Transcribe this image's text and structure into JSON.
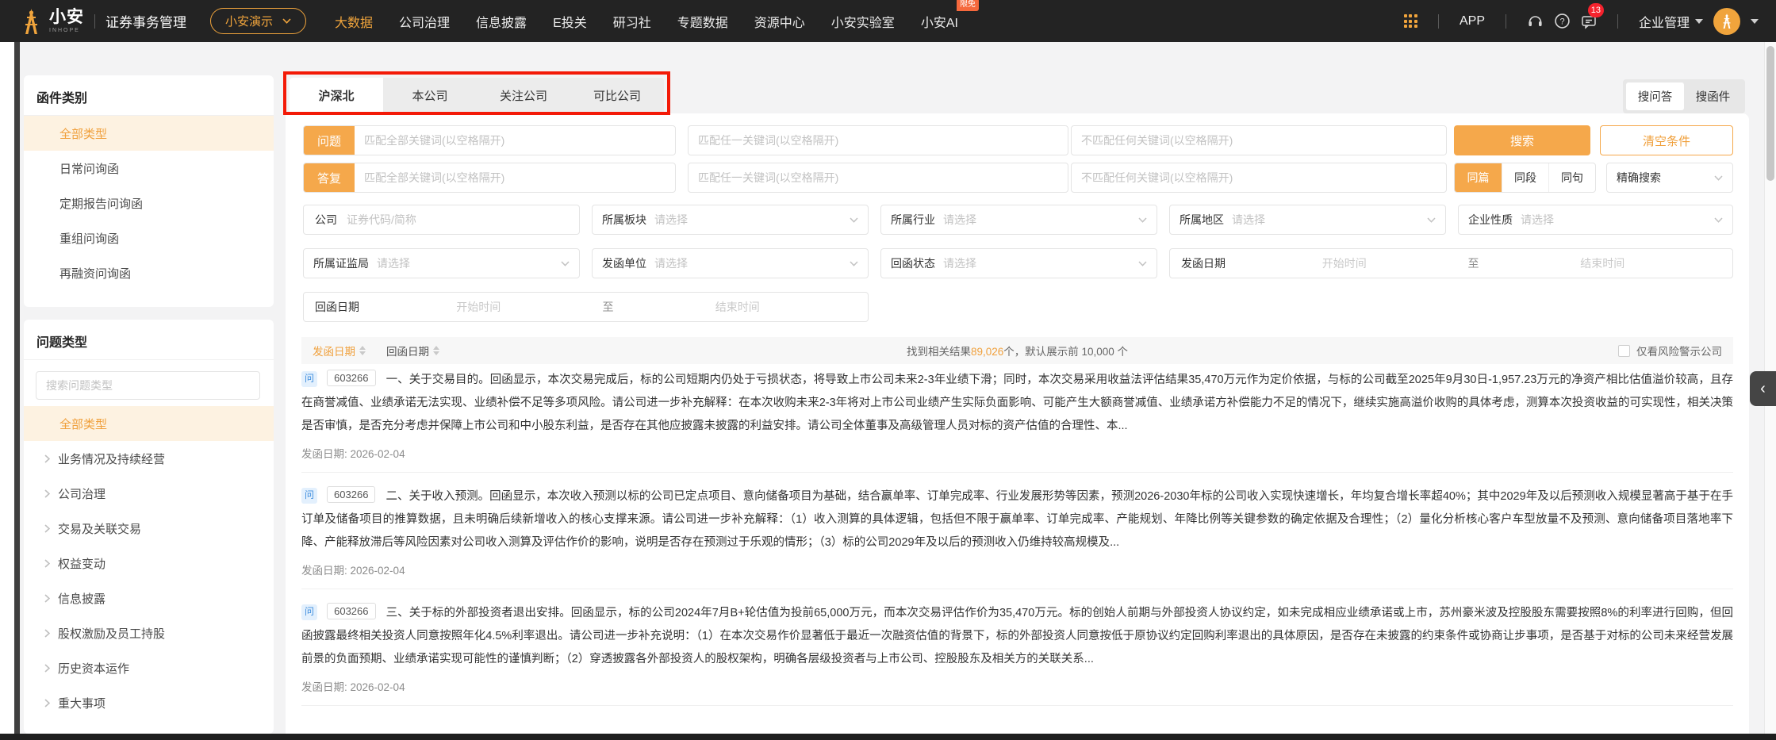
{
  "topbar": {
    "logo": {
      "text": "小安",
      "sub": "INHOPE"
    },
    "app_title": "证券事务管理",
    "env_selector": {
      "label": "小安演示"
    },
    "nav": [
      {
        "label": "大数据",
        "active": true
      },
      {
        "label": "公司治理"
      },
      {
        "label": "信息披露"
      },
      {
        "label": "E投关"
      },
      {
        "label": "研习社"
      },
      {
        "label": "专题数据"
      },
      {
        "label": "资源中心"
      },
      {
        "label": "小安实验室"
      },
      {
        "label": "小安AI",
        "badge": "限免"
      }
    ],
    "app_label": "APP",
    "message_badge": "13",
    "org_menu": {
      "label": "企业管理"
    }
  },
  "sidebar": {
    "letter_section": {
      "title": "函件类别",
      "items": [
        {
          "label": "全部类型",
          "selected": true
        },
        {
          "label": "日常问询函"
        },
        {
          "label": "定期报告问询函"
        },
        {
          "label": "重组问询函"
        },
        {
          "label": "再融资问询函"
        }
      ]
    },
    "question_section": {
      "title": "问题类型",
      "search_placeholder": "搜索问题类型",
      "all_item": {
        "label": "全部类型",
        "selected": true
      },
      "items": [
        {
          "label": "业务情况及持续经营"
        },
        {
          "label": "公司治理"
        },
        {
          "label": "交易及关联交易"
        },
        {
          "label": "权益变动"
        },
        {
          "label": "信息披露"
        },
        {
          "label": "股权激励及员工持股"
        },
        {
          "label": "历史资本运作"
        },
        {
          "label": "重大事项"
        }
      ]
    }
  },
  "main": {
    "tabs": [
      {
        "label": "沪深北",
        "active": true
      },
      {
        "label": "本公司"
      },
      {
        "label": "关注公司"
      },
      {
        "label": "可比公司"
      }
    ],
    "mode_toggle": [
      {
        "label": "搜问答",
        "active": true
      },
      {
        "label": "搜函件"
      }
    ],
    "search_form": {
      "question_label": "问题",
      "answer_label": "答复",
      "match_all_placeholder": "匹配全部关键词(以空格隔开)",
      "match_any_placeholder": "匹配任一关键词(以空格隔开)",
      "match_none_placeholder": "不匹配任何关键词(以空格隔开)",
      "search_button": "搜索",
      "clear_button": "清空条件",
      "scope_options": [
        {
          "label": "同篇",
          "active": true
        },
        {
          "label": "同段"
        },
        {
          "label": "同句"
        }
      ],
      "precise_select": "精确搜索"
    },
    "filters": {
      "company_label": "公司",
      "company_placeholder": "证券代码/简称",
      "select_placeholder": "请选择",
      "board_label": "所属板块",
      "industry_label": "所属行业",
      "region_label": "所属地区",
      "nature_label": "企业性质",
      "csrc_label": "所属证监局",
      "sender_label": "发函单位",
      "reply_status_label": "回函状态",
      "send_date_label": "发函日期",
      "reply_date_label": "回函日期",
      "date_start_placeholder": "开始时间",
      "date_to": "至",
      "date_end_placeholder": "结束时间"
    },
    "results": {
      "sort_send_date": "发函日期",
      "sort_reply_date": "回函日期",
      "count_prefix": "找到相关结果",
      "count": "89,026",
      "count_suffix": "个，默认展示前 10,000 个",
      "risk_filter_label": "仅看风险警示公司",
      "item_date_label": "发函日期: ",
      "items": [
        {
          "badge": "问",
          "code": "603266",
          "text": "一、关于交易目的。回函显示，本次交易完成后，标的公司短期内仍处于亏损状态，将导致上市公司未来2-3年业绩下滑；同时，本次交易采用收益法评估结果35,470万元作为定价依据，与标的公司截至2025年9月30日-1,957.23万元的净资产相比估值溢价较高，且存在商誉减值、业绩承诺无法实现、业绩补偿不足等多项风险。请公司进一步补充解释：在本次收购未来2-3年将对上市公司业绩产生实际负面影响、可能产生大额商誉减值、业绩承诺方补偿能力不足的情况下，继续实施高溢价收购的具体考虑，测算本次投资收益的可实现性，相关决策是否审慎，是否充分考虑并保障上市公司和中小股东利益，是否存在其他应披露未披露的利益安排。请公司全体董事及高级管理人员对标的资产估值的合理性、本...",
          "date": "2026-02-04"
        },
        {
          "badge": "问",
          "code": "603266",
          "text": "二、关于收入预测。回函显示，本次收入预测以标的公司已定点项目、意向储备项目为基础，结合赢单率、订单完成率、行业发展形势等因素，预测2026-2030年标的公司收入实现快速增长，年均复合增长率超40%；其中2029年及以后预测收入规模显著高于基于在手订单及储备项目的推算数据，且未明确后续新增收入的核心支撑来源。请公司进一步补充解释：（1）收入测算的具体逻辑，包括但不限于赢单率、订单完成率、产能规划、年降比例等关键参数的确定依据及合理性；（2）量化分析核心客户车型放量不及预测、意向储备项目落地率下降、产能释放滞后等风险因素对公司收入测算及评估作价的影响，说明是否存在预测过于乐观的情形；（3）标的公司2029年及以后的预测收入仍维持较高规模及...",
          "date": "2026-02-04"
        },
        {
          "badge": "问",
          "code": "603266",
          "text": "三、关于标的外部投资者退出安排。回函显示，标的公司2024年7月B+轮估值为投前65,000万元，而本次交易评估作价为35,470万元。标的创始人前期与外部投资人协议约定，如未完成相应业绩承诺或上市，苏州豪米波及控股股东需要按照8%的利率进行回购，但回函披露最终相关投资人同意按照年化4.5%利率退出。请公司进一步补充说明：（1）在本次交易作价显著低于最近一次融资估值的背景下，标的外部投资人同意按低于原协议约定回购利率退出的具体原因，是否存在未披露的约束条件或协商让步事项，是否基于对标的公司未来经营发展前景的负面预期、业绩承诺实现可能性的谨慎判断；（2）穿透披露各外部投资人的股权架构，明确各层级投资者与上市公司、控股股东及相关方的关联关系...",
          "date": "2026-02-04"
        }
      ]
    }
  }
}
